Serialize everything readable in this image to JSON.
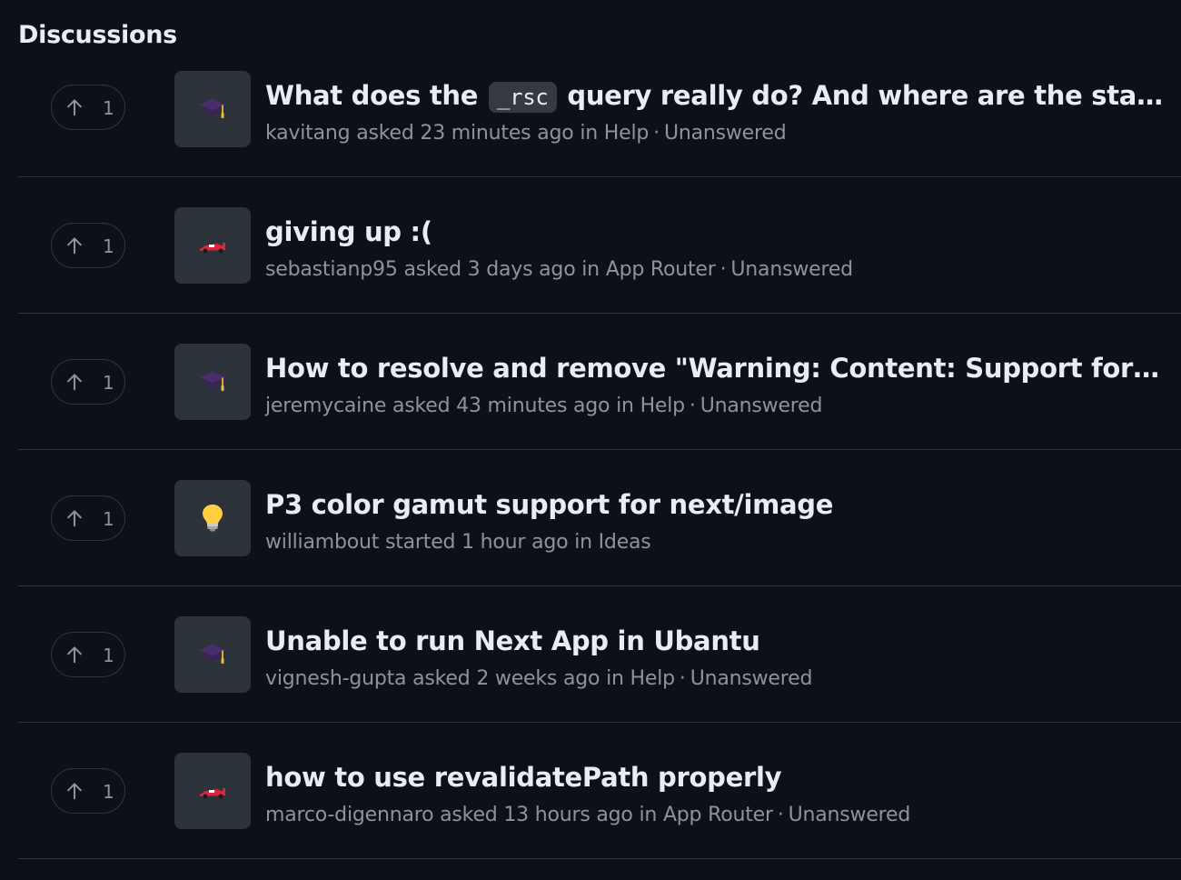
{
  "heading": "Discussions",
  "discussions": [
    {
      "upvotes": "1",
      "category_icon": "graduation-cap-icon",
      "title_before": "What does the",
      "title_code": "_rsc",
      "title_after": "query really do? And where are the static routes?",
      "author": "kavitang",
      "action": "asked",
      "time": "23 minutes ago",
      "in_word": "in",
      "category": "Help",
      "separator": "·",
      "status": "Unanswered"
    },
    {
      "upvotes": "1",
      "category_icon": "race-car-icon",
      "title": "giving up :(",
      "author": "sebastianp95",
      "action": "asked",
      "time": "3 days ago",
      "in_word": "in",
      "category": "App Router",
      "separator": "·",
      "status": "Unanswered"
    },
    {
      "upvotes": "1",
      "category_icon": "graduation-cap-icon",
      "title": "How to resolve and remove \"Warning: Content: Support for defaultProps will be removed\"",
      "author": "jeremycaine",
      "action": "asked",
      "time": "43 minutes ago",
      "in_word": "in",
      "category": "Help",
      "separator": "·",
      "status": "Unanswered"
    },
    {
      "upvotes": "1",
      "category_icon": "light-bulb-icon",
      "title": "P3 color gamut support for next/image",
      "author": "williambout",
      "action": "started",
      "time": "1 hour ago",
      "in_word": "in",
      "category": "Ideas",
      "separator": "",
      "status": ""
    },
    {
      "upvotes": "1",
      "category_icon": "graduation-cap-icon",
      "title": "Unable to run Next App in Ubantu",
      "author": "vignesh-gupta",
      "action": "asked",
      "time": "2 weeks ago",
      "in_word": "in",
      "category": "Help",
      "separator": "·",
      "status": "Unanswered"
    },
    {
      "upvotes": "1",
      "category_icon": "race-car-icon",
      "title": "how to use revalidatePath properly",
      "author": "marco-digennaro",
      "action": "asked",
      "time": "13 hours ago",
      "in_word": "in",
      "category": "App Router",
      "separator": "·",
      "status": "Unanswered"
    }
  ]
}
